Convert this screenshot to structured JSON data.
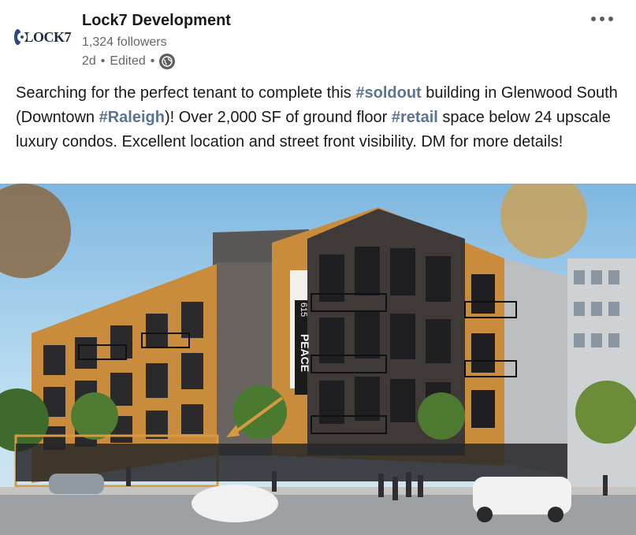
{
  "post": {
    "author": {
      "name": "Lock7 Development",
      "followers": "1,324 followers",
      "time": "2d",
      "edited": "Edited",
      "separator": "•",
      "logo_text": "LOCK7"
    },
    "body": {
      "t1": "Searching for the perfect tenant to complete this ",
      "h1": "#soldout",
      "t2": " building in Glenwood South (Downtown ",
      "h2": "#Raleigh",
      "t3": ")! Over 2,000 SF of ground floor ",
      "h3": "#retail",
      "t4": " space below 24 upscale luxury condos. Excellent location and street front visibility. DM for more details!"
    },
    "image": {
      "sign_number": "615",
      "sign_word": "PEACE"
    },
    "icons": {
      "more": "more-options-icon",
      "visibility": "globe-icon"
    },
    "colors": {
      "hashtag": "#5b7494",
      "meta_text": "#666666",
      "building_orange": "#c98b3c"
    }
  }
}
